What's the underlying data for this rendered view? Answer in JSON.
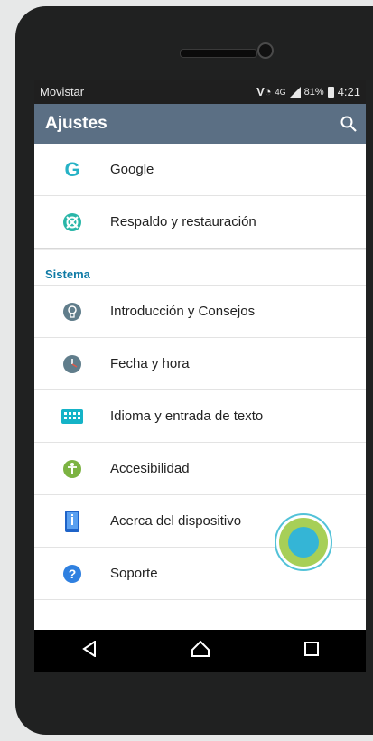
{
  "status_bar": {
    "carrier": "Movistar",
    "network": "4G",
    "battery": "81%",
    "time": "4:21"
  },
  "app_bar": {
    "title": "Ajustes",
    "search_icon": "search-icon"
  },
  "top_items": [
    {
      "label": "Google",
      "icon": "google-icon"
    },
    {
      "label": "Respaldo y restauración",
      "icon": "backup-restore-icon"
    }
  ],
  "system_section": {
    "header": "Sistema",
    "items": [
      {
        "label": "Introducción y Consejos",
        "icon": "lightbulb-icon"
      },
      {
        "label": "Fecha y hora",
        "icon": "clock-icon"
      },
      {
        "label": "Idioma y entrada de texto",
        "icon": "keyboard-icon"
      },
      {
        "label": "Accesibilidad",
        "icon": "accessibility-icon"
      },
      {
        "label": "Acerca del dispositivo",
        "icon": "device-info-icon"
      },
      {
        "label": "Soporte",
        "icon": "help-icon"
      }
    ]
  },
  "nav_bar": {
    "back": "back-icon",
    "home": "home-icon",
    "recents": "recents-icon"
  },
  "colors": {
    "app_bar": "#5b6f84",
    "section_header": "#0e7aa5",
    "touch_outer": "#a7cf57",
    "touch_core": "#34b5d6"
  }
}
